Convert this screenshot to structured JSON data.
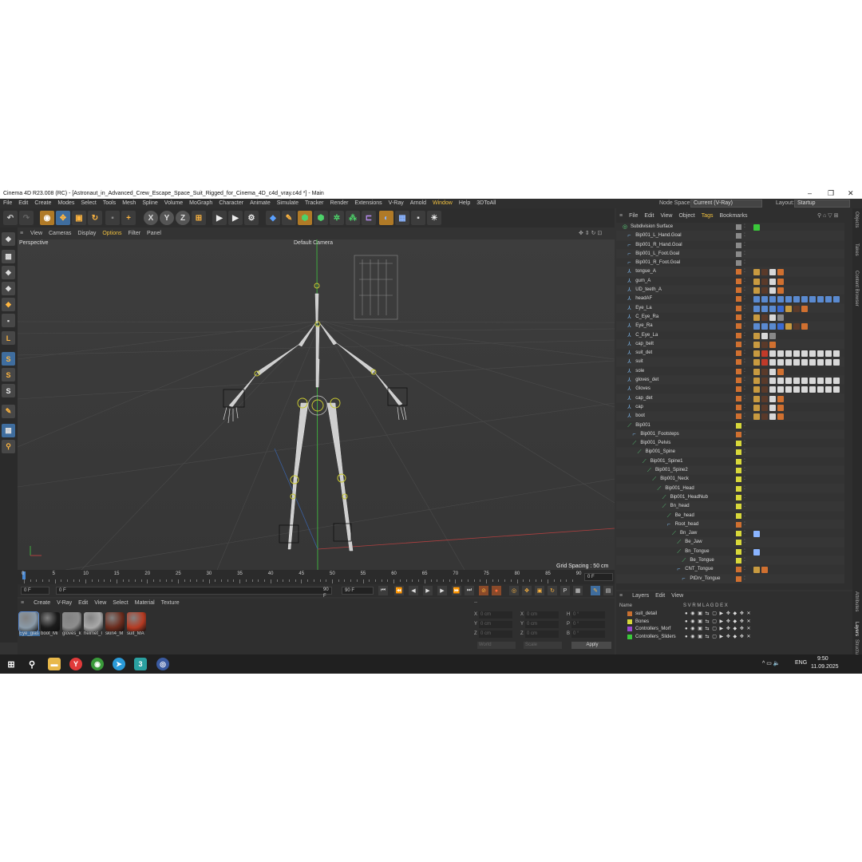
{
  "window": {
    "title": "Cinema 4D R23.008 (RC) - [Astronaut_in_Advanced_Crew_Escape_Space_Suit_Rigged_for_Cinema_4D_c4d_vray.c4d *] - Main",
    "controls": [
      "–",
      "❐",
      "✕"
    ]
  },
  "menubar": {
    "items": [
      "File",
      "Edit",
      "Create",
      "Modes",
      "Select",
      "Tools",
      "Mesh",
      "Spline",
      "Volume",
      "MoGraph",
      "Character",
      "Animate",
      "Simulate",
      "Tracker",
      "Render",
      "Extensions",
      "V-Ray",
      "Arnold",
      "Window",
      "Help",
      "3DToAll"
    ],
    "node_space_label": "Node Space:",
    "node_space_value": "Current (V-Ray)",
    "layout_label": "Layout:",
    "layout_value": "Startup"
  },
  "toolbar": {
    "axis_x": "X",
    "axis_y": "Y",
    "axis_z": "Z"
  },
  "left_tools": {
    "s_labels": [
      "S",
      "S",
      "S"
    ]
  },
  "viewport": {
    "menu": [
      "View",
      "Cameras",
      "Display",
      "Options",
      "Filter",
      "Panel"
    ],
    "view_name": "Perspective",
    "camera_name": "Default Camera",
    "grid_spacing": "Grid Spacing : 50 cm"
  },
  "timeline": {
    "ticks": [
      "0",
      "5",
      "10",
      "15",
      "20",
      "25",
      "30",
      "35",
      "40",
      "45",
      "50",
      "55",
      "60",
      "65",
      "70",
      "75",
      "80",
      "85",
      "90"
    ],
    "current_frame_right": "0 F",
    "start_frame": "0 F",
    "range_start": "0 F",
    "range_end": "90 F",
    "end_frame": "90 F"
  },
  "material_manager": {
    "menu": [
      "Create",
      "V-Ray",
      "Edit",
      "View",
      "Select",
      "Material",
      "Texture"
    ],
    "materials": [
      {
        "name": "Eye_glas",
        "color": "#8a9aa8"
      },
      {
        "name": "boot_Mi",
        "color": "#1b1b1b"
      },
      {
        "name": "gloves_k",
        "color": "#8d8d8d"
      },
      {
        "name": "helmet_I",
        "color": "#a9a9a9"
      },
      {
        "name": "skin4_M",
        "color": "#6b2b1c"
      },
      {
        "name": "suit_MA",
        "color": "#b53a22"
      }
    ]
  },
  "coordinates": {
    "header": "--",
    "rows": [
      {
        "a": "X",
        "av": "0 cm",
        "b": "X",
        "bv": "0 cm",
        "c": "H",
        "cv": "0 °"
      },
      {
        "a": "Y",
        "av": "0 cm",
        "b": "Y",
        "bv": "0 cm",
        "c": "P",
        "cv": "0 °"
      },
      {
        "a": "Z",
        "av": "0 cm",
        "b": "Z",
        "bv": "0 cm",
        "c": "B",
        "cv": "0 °"
      }
    ],
    "mode_world": "World",
    "mode_scale": "Scale",
    "apply": "Apply"
  },
  "object_manager": {
    "menu": [
      "File",
      "Edit",
      "View",
      "Object",
      "Tags",
      "Bookmarks"
    ],
    "objects": [
      {
        "name": "Subdivision Surface",
        "indent": 0,
        "icon": "subdiv",
        "sq": "#8a8a8a",
        "tags": [
          "check"
        ]
      },
      {
        "name": "Bip001_L_Hand.Goal",
        "indent": 1,
        "icon": "null",
        "sq": "#8a8a8a",
        "tags": []
      },
      {
        "name": "Bip001_R_Hand.Goal",
        "indent": 1,
        "icon": "null",
        "sq": "#8a8a8a",
        "tags": []
      },
      {
        "name": "Bip001_L_Foot.Goal",
        "indent": 1,
        "icon": "null",
        "sq": "#8a8a8a",
        "tags": []
      },
      {
        "name": "Bip001_R_Foot.Goal",
        "indent": 1,
        "icon": "null",
        "sq": "#8a8a8a",
        "tags": []
      },
      {
        "name": "tongue_A",
        "indent": 1,
        "icon": "poly",
        "sq": "#d07030",
        "tags": [
          "w",
          "b",
          "c",
          "o"
        ]
      },
      {
        "name": "gum_A",
        "indent": 1,
        "icon": "poly",
        "sq": "#d07030",
        "tags": [
          "w",
          "b",
          "c",
          "o"
        ]
      },
      {
        "name": "UD_teeth_A",
        "indent": 1,
        "icon": "poly",
        "sq": "#d07030",
        "tags": [
          "w",
          "b",
          "c",
          "o"
        ]
      },
      {
        "name": "headAF",
        "indent": 1,
        "icon": "poly",
        "sq": "#d07030",
        "tags": [
          "p",
          "p",
          "p",
          "p",
          "p",
          "p",
          "p",
          "p",
          "p",
          "p",
          "p"
        ]
      },
      {
        "name": "Eye_La",
        "indent": 1,
        "icon": "poly",
        "sq": "#d07030",
        "tags": [
          "p",
          "p",
          "p",
          "blue",
          "w",
          "b",
          "o"
        ]
      },
      {
        "name": "C_Eye_Ra",
        "indent": 1,
        "icon": "poly",
        "sq": "#d07030",
        "tags": [
          "w",
          "b",
          "c",
          "g"
        ]
      },
      {
        "name": "Eye_Ra",
        "indent": 1,
        "icon": "poly",
        "sq": "#d07030",
        "tags": [
          "p",
          "p",
          "p",
          "blue",
          "w",
          "b",
          "o"
        ]
      },
      {
        "name": "C_Eye_La",
        "indent": 1,
        "icon": "poly",
        "sq": "#d07030",
        "tags": [
          "w",
          "c",
          "g"
        ]
      },
      {
        "name": "cap_belt",
        "indent": 1,
        "icon": "poly",
        "sq": "#d07030",
        "tags": [
          "w",
          "b",
          "o"
        ]
      },
      {
        "name": "suit_det",
        "indent": 1,
        "icon": "poly",
        "sq": "#d07030",
        "tags": [
          "w",
          "r",
          "c",
          "c",
          "c",
          "c",
          "c",
          "c",
          "c",
          "c",
          "c"
        ]
      },
      {
        "name": "suit",
        "indent": 1,
        "icon": "poly",
        "sq": "#d07030",
        "tags": [
          "w",
          "r",
          "c",
          "c",
          "c",
          "c",
          "c",
          "c",
          "c",
          "c",
          "c"
        ]
      },
      {
        "name": "sole",
        "indent": 1,
        "icon": "poly",
        "sq": "#d07030",
        "tags": [
          "w",
          "b",
          "c",
          "o"
        ]
      },
      {
        "name": "gloves_det",
        "indent": 1,
        "icon": "poly",
        "sq": "#d07030",
        "tags": [
          "w",
          "b",
          "c",
          "c",
          "c",
          "c",
          "c",
          "c",
          "c",
          "c",
          "c"
        ]
      },
      {
        "name": "Gloves",
        "indent": 1,
        "icon": "poly",
        "sq": "#d07030",
        "tags": [
          "w",
          "b",
          "c",
          "c",
          "c",
          "c",
          "c",
          "c",
          "c",
          "c",
          "c"
        ]
      },
      {
        "name": "cap_det",
        "indent": 1,
        "icon": "poly",
        "sq": "#d07030",
        "tags": [
          "w",
          "b",
          "c",
          "o"
        ]
      },
      {
        "name": "cap",
        "indent": 1,
        "icon": "poly",
        "sq": "#d07030",
        "tags": [
          "w",
          "b",
          "c",
          "o"
        ]
      },
      {
        "name": "boot",
        "indent": 1,
        "icon": "poly",
        "sq": "#d07030",
        "tags": [
          "w",
          "b",
          "c",
          "o"
        ]
      },
      {
        "name": "Bip001",
        "indent": 1,
        "icon": "bone",
        "sq": "#d8d83a",
        "tags": []
      },
      {
        "name": "Bip001_Footsteps",
        "indent": 2,
        "icon": "null",
        "sq": "#d07030",
        "tags": []
      },
      {
        "name": "Bip001_Pelvis",
        "indent": 2,
        "icon": "bone",
        "sq": "#d8d83a",
        "tags": []
      },
      {
        "name": "Bip001_Spine",
        "indent": 3,
        "icon": "bone",
        "sq": "#d8d83a",
        "tags": []
      },
      {
        "name": "Bip001_Spine1",
        "indent": 4,
        "icon": "bone",
        "sq": "#d8d83a",
        "tags": []
      },
      {
        "name": "Bip001_Spine2",
        "indent": 5,
        "icon": "bone",
        "sq": "#d8d83a",
        "tags": []
      },
      {
        "name": "Bip001_Neck",
        "indent": 6,
        "icon": "bone",
        "sq": "#d8d83a",
        "tags": []
      },
      {
        "name": "Bip001_Head",
        "indent": 7,
        "icon": "bone",
        "sq": "#d8d83a",
        "tags": []
      },
      {
        "name": "Bip001_HeadNub",
        "indent": 8,
        "icon": "bone",
        "sq": "#d8d83a",
        "tags": []
      },
      {
        "name": "Bn_head",
        "indent": 8,
        "icon": "bone",
        "sq": "#d8d83a",
        "tags": []
      },
      {
        "name": "Be_head",
        "indent": 9,
        "icon": "bone",
        "sq": "#d8d83a",
        "tags": []
      },
      {
        "name": "Root_head",
        "indent": 9,
        "icon": "null",
        "sq": "#d07030",
        "tags": []
      },
      {
        "name": "Bn_Jaw",
        "indent": 10,
        "icon": "bone",
        "sq": "#d8d83a",
        "tags": [
          "ik"
        ]
      },
      {
        "name": "Be_Jaw",
        "indent": 11,
        "icon": "bone",
        "sq": "#d8d83a",
        "tags": []
      },
      {
        "name": "Bn_Tongue",
        "indent": 11,
        "icon": "bone",
        "sq": "#d8d83a",
        "tags": [
          "ik"
        ]
      },
      {
        "name": "Be_Tongue",
        "indent": 12,
        "icon": "bone",
        "sq": "#d8d83a",
        "tags": []
      },
      {
        "name": "CNT_Tongue",
        "indent": 11,
        "icon": "null",
        "sq": "#d07030",
        "tags": [
          "w",
          "o"
        ]
      },
      {
        "name": "PtDrv_Tongue",
        "indent": 12,
        "icon": "null",
        "sq": "#d07030",
        "tags": []
      }
    ]
  },
  "layers": {
    "menu": [
      "Layers",
      "Edit",
      "View"
    ],
    "columns_name": "Name",
    "columns_flags": "S  V  R  M  L  A  G  D  E  X",
    "rows": [
      {
        "name": "suit_detail",
        "color": "#c87030"
      },
      {
        "name": "Bones",
        "color": "#d8d83a"
      },
      {
        "name": "Controllers_Morf",
        "color": "#9a4ad0"
      },
      {
        "name": "Controllers_Sliders",
        "color": "#3ac83a"
      }
    ]
  },
  "side_tabs": [
    "Objects",
    "Takes",
    "Content Browser",
    "Attributes",
    "Layers",
    "Structure"
  ],
  "taskbar": {
    "language": "ENG",
    "time": "9:50",
    "date": "11.09.2025"
  }
}
